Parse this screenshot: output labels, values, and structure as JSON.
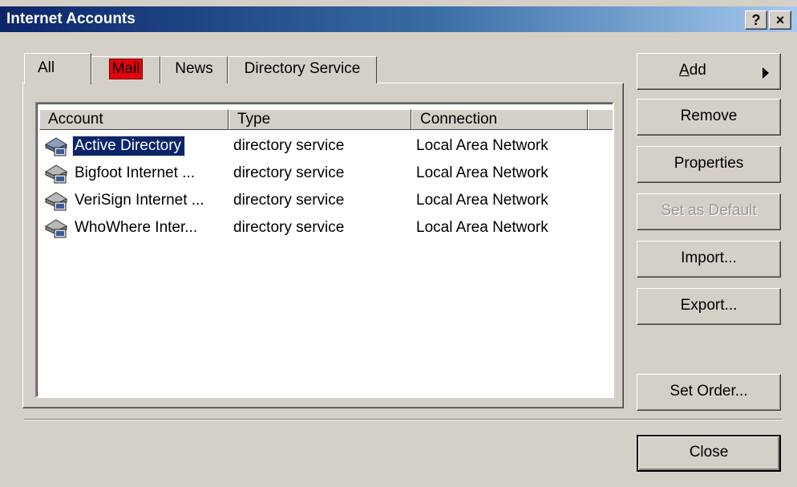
{
  "window": {
    "title": "Internet Accounts",
    "help_label": "?",
    "close_label": "×"
  },
  "tabs": [
    {
      "label": "All"
    },
    {
      "label": "Mail"
    },
    {
      "label": "News"
    },
    {
      "label": "Directory Service"
    }
  ],
  "columns": [
    "Account",
    "Type",
    "Connection",
    ""
  ],
  "rows": [
    {
      "account": "Active Directory",
      "type": "directory service",
      "connection": "Local Area Network"
    },
    {
      "account": "Bigfoot Internet ...",
      "type": "directory service",
      "connection": "Local Area Network"
    },
    {
      "account": "VeriSign Internet ...",
      "type": "directory service",
      "connection": "Local Area Network"
    },
    {
      "account": "WhoWhere Inter...",
      "type": "directory service",
      "connection": "Local Area Network"
    }
  ],
  "buttons": {
    "add_underlined": "A",
    "add_rest": "dd",
    "remove": "Remove",
    "properties": "Properties",
    "set_default": "Set as Default",
    "import": "Import...",
    "export": "Export...",
    "set_order": "Set Order...",
    "close": "Close"
  },
  "colors": {
    "selection": "#0a246a",
    "mail_tab_highlight": "#e8000a",
    "face": "#d4d0c8"
  },
  "icons": {
    "account_icon": "directory-service-icon",
    "add_arrow": "right-triangle-icon"
  }
}
